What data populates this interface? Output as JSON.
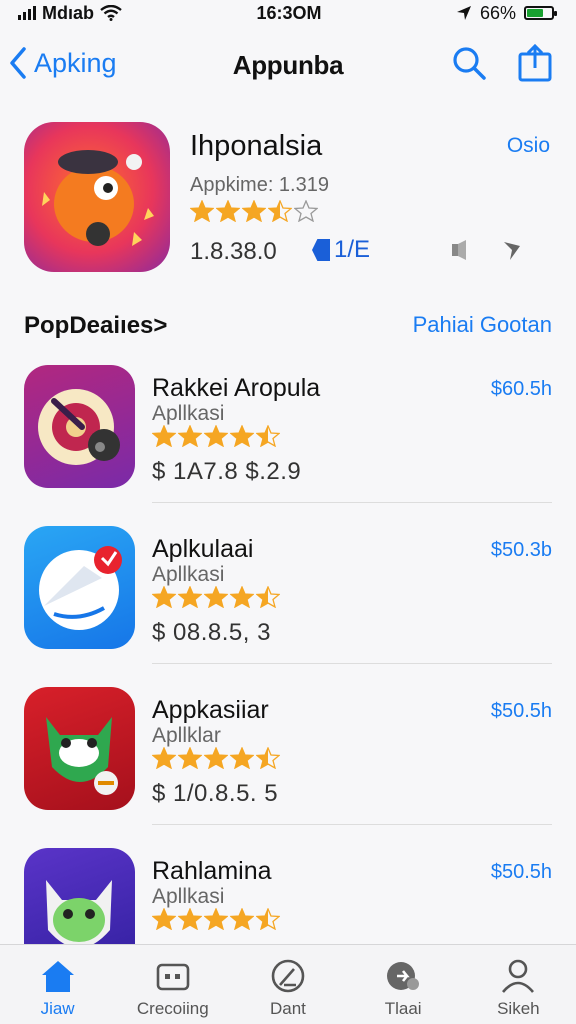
{
  "status_bar": {
    "carrier": "Mdıab",
    "time": "16:3OM",
    "battery": "66%",
    "battery_level": 0.66
  },
  "nav": {
    "back_label": "Apking",
    "title": "Appunba"
  },
  "featured": {
    "name": "Ihponalsia",
    "subtitle": "Appkime: 1.319",
    "rating": 3.5,
    "size": "1.8.38.0",
    "badge": "1/E",
    "action": "Osio"
  },
  "section": {
    "title": "PopDeaiıes>",
    "link": "Pahiai Gootan"
  },
  "apps": [
    {
      "name": "Rakkei Aropula",
      "category": "Apllkasi",
      "rating": 4.5,
      "meta": "$ 1A7.8 $.2.9",
      "price": "$60.5h"
    },
    {
      "name": "Aplkulaai",
      "category": "Apllkasi",
      "rating": 4.5,
      "meta": "$ 08.8.5, 3",
      "price": "$50.3b"
    },
    {
      "name": "Appkasiiar",
      "category": "Apllklar",
      "rating": 4.5,
      "meta": "$ 1/0.8.5. 5",
      "price": "$50.5h"
    },
    {
      "name": "Rahlamina",
      "category": "Apllkasi",
      "rating": 4.5,
      "meta": "",
      "price": "$50.5h"
    }
  ],
  "tabs": [
    {
      "label": "Jiaw",
      "icon": "home-icon"
    },
    {
      "label": "Crecoiing",
      "icon": "games-icon"
    },
    {
      "label": "Dant",
      "icon": "apps-icon"
    },
    {
      "label": "Tlaai",
      "icon": "updates-icon"
    },
    {
      "label": "Sikeh",
      "icon": "profile-icon"
    }
  ],
  "colors": {
    "accent": "#1a7cf2",
    "star": "#f5a623",
    "background": "#f7f7f9"
  }
}
